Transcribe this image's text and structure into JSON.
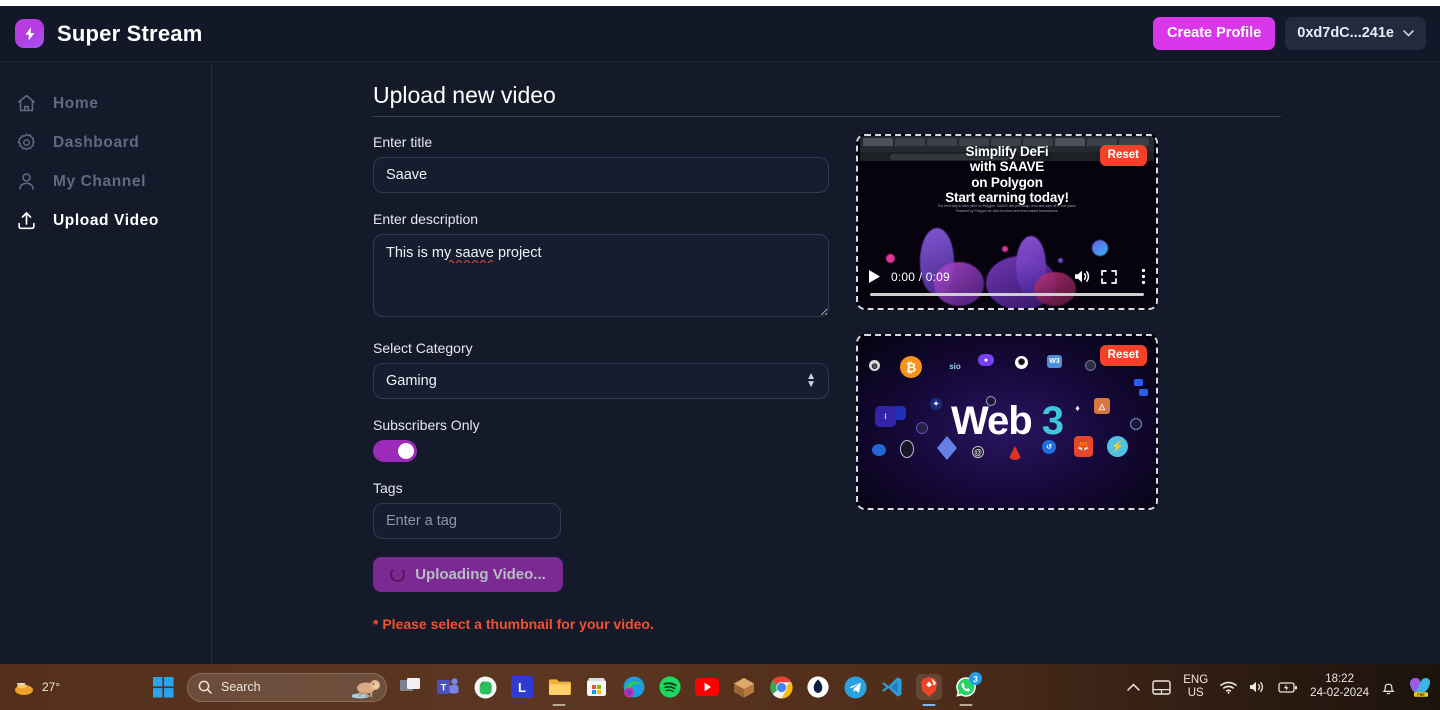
{
  "header": {
    "brand": "Super Stream",
    "logo_icon": "lightning-bolt-icon",
    "create_profile_label": "Create Profile",
    "wallet_address": "0xd7dC...241e",
    "wallet_chevron": "∨",
    "accent_color": "#d838ea"
  },
  "sidebar": {
    "items": [
      {
        "label": "Home",
        "icon": "home-icon",
        "active": false
      },
      {
        "label": "Dashboard",
        "icon": "gear-icon",
        "active": false
      },
      {
        "label": "My Channel",
        "icon": "user-icon",
        "active": false
      },
      {
        "label": "Upload Video",
        "icon": "upload-icon",
        "active": true
      }
    ]
  },
  "main": {
    "page_title": "Upload new video",
    "fields": {
      "title_label": "Enter title",
      "title_value": "Saave",
      "description_label": "Enter description",
      "description_value": "This is my saave project",
      "category_label": "Select Category",
      "category_value": "Gaming",
      "category_options": [
        "Gaming"
      ],
      "subscribers_label": "Subscribers Only",
      "subscribers_on": true,
      "tags_label": "Tags",
      "tags_value": "",
      "tags_placeholder": "Enter a tag"
    },
    "submit_button_label": "Uploading Video...",
    "submit_button_busy": true,
    "error_message": "* Please select a thumbnail for your video.",
    "error_color": "#f4502e"
  },
  "media": {
    "reset_label": "Reset",
    "reset_color": "#f4422a",
    "video": {
      "headline_lines": [
        "Simplify DeFi",
        "with SAAVE",
        "on Polygon",
        "Start earning today!"
      ],
      "subtext_lines": [
        "The best way to earn yield on Polygon. SAAVE lets you swap, lend and earn all in one place.",
        "Powered by Polygon for ultra-low fees and near-instant transactions."
      ],
      "current_time": "0:00",
      "duration": "0:09",
      "time_display": "0:00 / 0:09",
      "controls": [
        "play-icon",
        "volume-icon",
        "fullscreen-icon",
        "more-options-icon"
      ]
    },
    "thumbnail": {
      "title_primary": "Web",
      "title_accent": "3",
      "label_sio": "sio"
    }
  },
  "taskbar": {
    "weather_temp": "27°",
    "search_placeholder": "Search",
    "search_icon": "search-icon",
    "start_icon": "windows-start-icon",
    "apps": [
      {
        "name": "task-view-icon"
      },
      {
        "name": "microsoft-teams-icon"
      },
      {
        "name": "evernote-icon"
      },
      {
        "name": "lastpass-icon"
      },
      {
        "name": "file-explorer-icon"
      },
      {
        "name": "microsoft-store-icon"
      },
      {
        "name": "microsoft-edge-icon"
      },
      {
        "name": "spotify-icon"
      },
      {
        "name": "youtube-icon"
      },
      {
        "name": "parcel-icon"
      },
      {
        "name": "google-chrome-icon"
      },
      {
        "name": "brave-leo-icon"
      },
      {
        "name": "telegram-icon"
      },
      {
        "name": "vscode-icon"
      },
      {
        "name": "brave-browser-icon"
      },
      {
        "name": "whatsapp-icon"
      }
    ],
    "whatsapp_badge": "3",
    "tray": {
      "chevron_icon": "show-hidden-icons-icon",
      "touchpad_icon": "touchpad-icon",
      "language_line1": "ENG",
      "language_line2": "US",
      "wifi_icon": "wifi-icon",
      "volume_icon": "volume-icon",
      "battery_icon": "battery-charging-icon",
      "time": "18:22",
      "date": "24-02-2024",
      "notification_icon": "notifications-bell-icon",
      "copilot_icon": "copilot-icon"
    }
  }
}
